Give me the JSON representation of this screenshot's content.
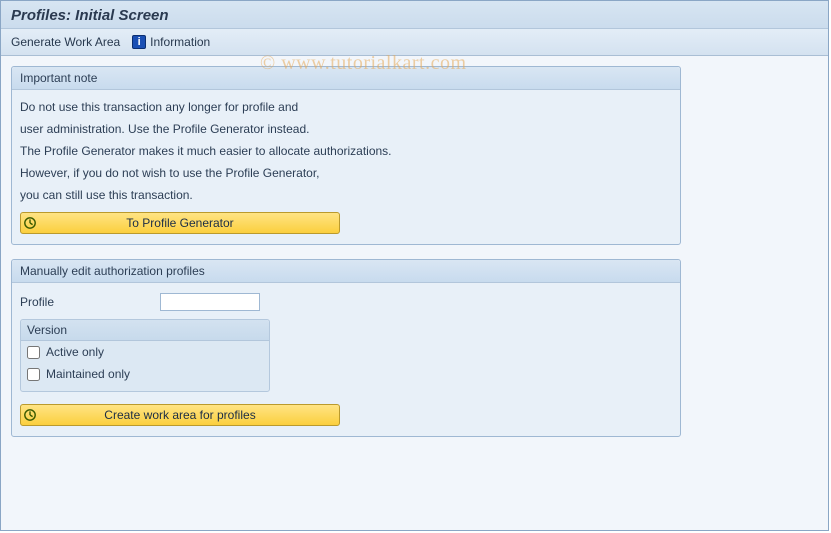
{
  "title": "Profiles: Initial Screen",
  "watermark": "© www.tutorialkart.com",
  "toolbar": {
    "generate": "Generate Work Area",
    "info": "Information"
  },
  "note": {
    "header": "Important note",
    "lines": [
      "Do not use this transaction any longer for profile and",
      "user administration. Use the Profile Generator instead.",
      "The Profile Generator makes it much easier to allocate authorizations.",
      "However, if you do not wish to use the Profile Generator,",
      "you can still use this transaction."
    ],
    "button": "To Profile Generator"
  },
  "edit": {
    "header": "Manually edit authorization profiles",
    "profile_label": "Profile",
    "profile_value": "",
    "version": {
      "header": "Version",
      "active": "Active only",
      "maintained": "Maintained only"
    },
    "button": "Create work area for profiles"
  }
}
